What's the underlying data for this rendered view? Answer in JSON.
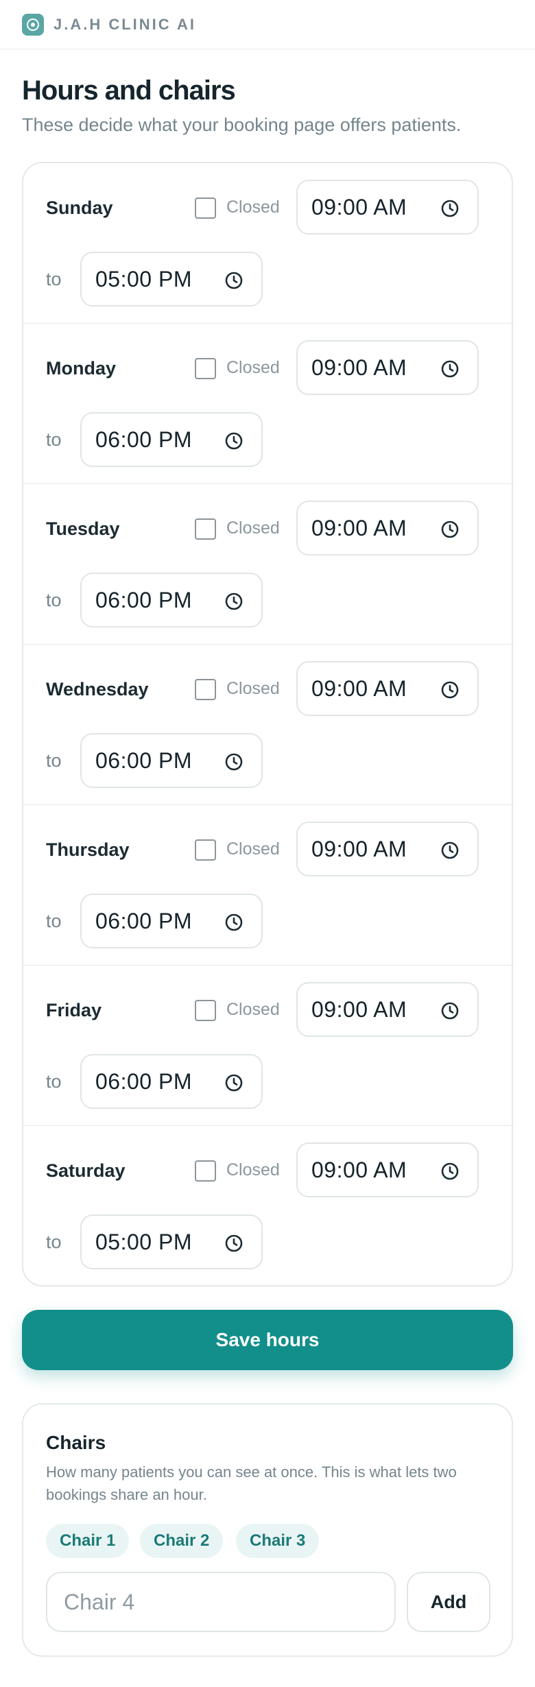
{
  "brand": {
    "name": "J.A.H CLINIC AI"
  },
  "page": {
    "title": "Hours and chairs",
    "subtitle": "These decide what your booking page offers patients."
  },
  "hours": {
    "closed_label": "Closed",
    "to_label": "to",
    "days": [
      {
        "name": "Sunday",
        "open": "09:00 AM",
        "close": "05:00 PM",
        "closed": false
      },
      {
        "name": "Monday",
        "open": "09:00 AM",
        "close": "06:00 PM",
        "closed": false
      },
      {
        "name": "Tuesday",
        "open": "09:00 AM",
        "close": "06:00 PM",
        "closed": false
      },
      {
        "name": "Wednesday",
        "open": "09:00 AM",
        "close": "06:00 PM",
        "closed": false
      },
      {
        "name": "Thursday",
        "open": "09:00 AM",
        "close": "06:00 PM",
        "closed": false
      },
      {
        "name": "Friday",
        "open": "09:00 AM",
        "close": "06:00 PM",
        "closed": false
      },
      {
        "name": "Saturday",
        "open": "09:00 AM",
        "close": "05:00 PM",
        "closed": false
      }
    ],
    "save_label": "Save hours"
  },
  "chairs": {
    "title": "Chairs",
    "description": "How many patients you can see at once. This is what lets two bookings share an hour.",
    "items": [
      "Chair 1",
      "Chair 2",
      "Chair 3"
    ],
    "input_placeholder": "Chair 4",
    "add_label": "Add"
  },
  "colors": {
    "accent": "#128f8b",
    "chip_bg": "#e9f5f4",
    "chip_text": "#1a7b78"
  }
}
